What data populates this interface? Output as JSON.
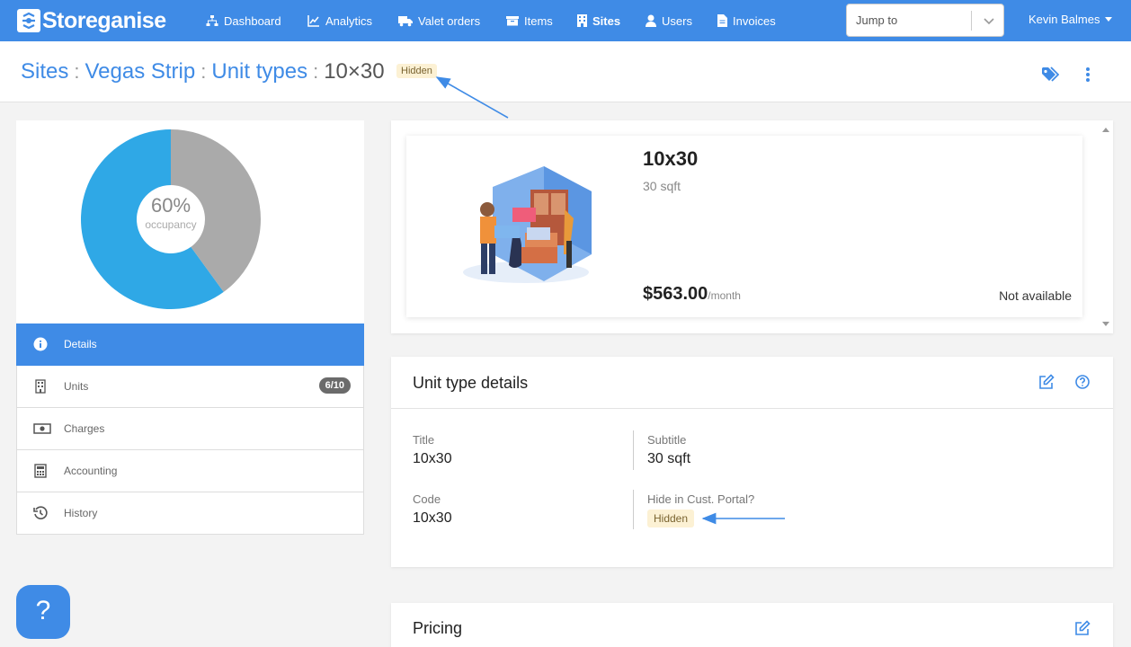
{
  "brand": {
    "name": "Storeganise",
    "accent": "#3f8be6"
  },
  "nav": {
    "items": [
      {
        "label": "Dashboard",
        "icon": "sitemap-icon"
      },
      {
        "label": "Analytics",
        "icon": "chart-icon"
      },
      {
        "label": "Valet orders",
        "icon": "truck-icon"
      },
      {
        "label": "Items",
        "icon": "box-icon"
      },
      {
        "label": "Sites",
        "icon": "building-icon",
        "active": true
      },
      {
        "label": "Users",
        "icon": "user-icon"
      },
      {
        "label": "Invoices",
        "icon": "file-icon"
      }
    ],
    "jump_to_placeholder": "Jump to",
    "user_name": "Kevin Balmes"
  },
  "breadcrumb": {
    "items": [
      "Sites",
      "Vegas Strip",
      "Unit types"
    ],
    "separator": ":",
    "current": "10×30",
    "status_badge": "Hidden"
  },
  "occupancy": {
    "percent_label": "60%",
    "label": "occupancy",
    "value": 0.6,
    "occupied_color": "#2fa8e6",
    "free_color": "#aaaaaa"
  },
  "sidemenu": {
    "items": [
      {
        "label": "Details",
        "icon": "info-icon",
        "active": true
      },
      {
        "label": "Units",
        "icon": "building-icon",
        "badge": "6/10"
      },
      {
        "label": "Charges",
        "icon": "money-icon"
      },
      {
        "label": "Accounting",
        "icon": "calculator-icon"
      },
      {
        "label": "History",
        "icon": "history-icon"
      }
    ]
  },
  "unit": {
    "title": "10x30",
    "subtitle": "30 sqft",
    "price": "$563.00",
    "price_period": "/month",
    "availability": "Not available"
  },
  "details": {
    "title": "Unit type details",
    "fields": {
      "title_label": "Title",
      "title_value": "10x30",
      "subtitle_label": "Subtitle",
      "subtitle_value": "30 sqft",
      "code_label": "Code",
      "code_value": "10x30",
      "hide_label": "Hide in Cust. Portal?",
      "hide_value": "Hidden"
    }
  },
  "pricing": {
    "title": "Pricing"
  },
  "help": {
    "label": "?"
  }
}
